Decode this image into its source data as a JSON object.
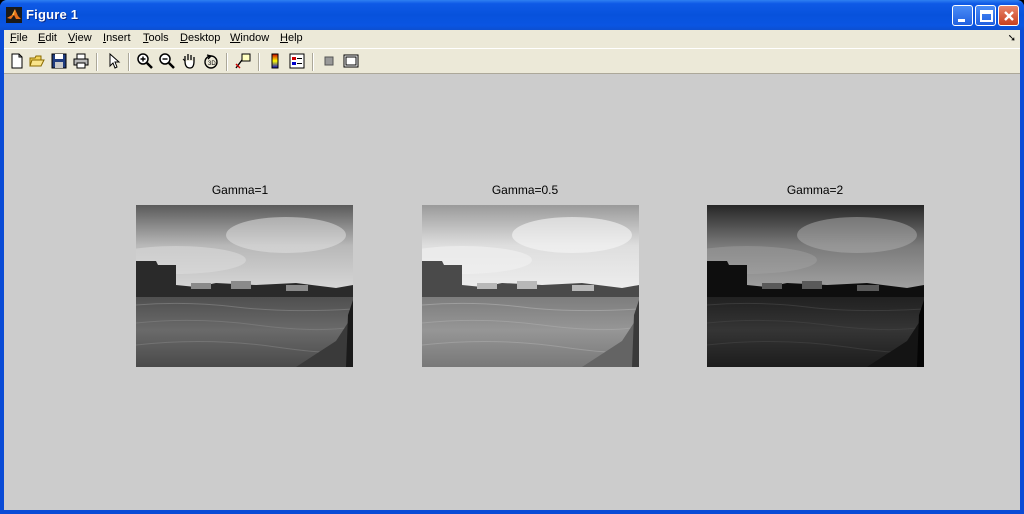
{
  "window": {
    "title": "Figure 1"
  },
  "menu": [
    "File",
    "Edit",
    "View",
    "Insert",
    "Tools",
    "Desktop",
    "Window",
    "Help"
  ],
  "menu_underline": [
    "F",
    "E",
    "V",
    "I",
    "T",
    "D",
    "W",
    "H"
  ],
  "toolbar": [
    "new-figure",
    "open-file",
    "save-figure",
    "print-figure",
    "edit-plot",
    "zoom-in",
    "zoom-out",
    "pan",
    "rotate-3d",
    "data-cursor",
    "insert-colorbar",
    "insert-legend",
    "hide-plot-tools",
    "show-plot-tools"
  ],
  "panels": [
    {
      "title": "Gamma=1",
      "gamma": 1
    },
    {
      "title": "Gamma=0.5",
      "gamma": 0.5
    },
    {
      "title": "Gamma=2",
      "gamma": 2
    }
  ]
}
